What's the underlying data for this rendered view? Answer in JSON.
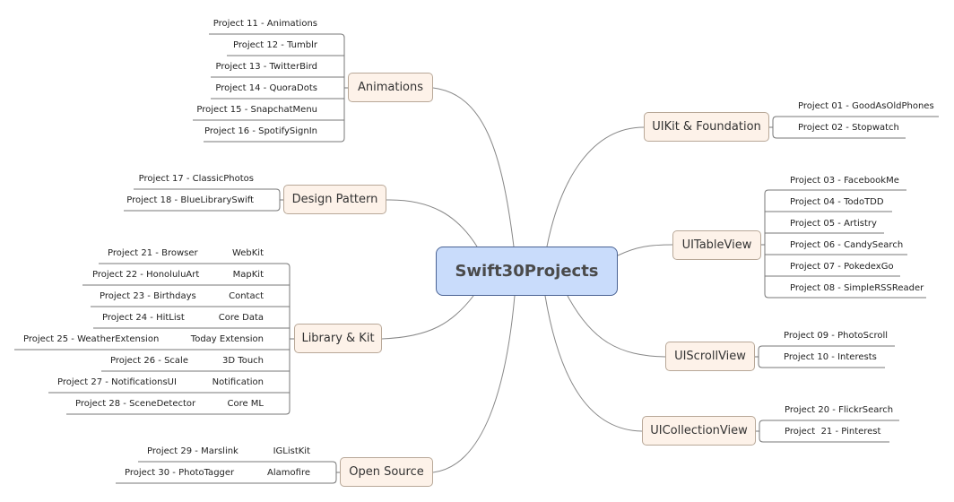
{
  "root": {
    "label": "Swift30Projects",
    "fill": "#c9dcfb",
    "border": "#4a6394"
  },
  "colors": {
    "branch_fill": "#fdf2e9",
    "branch_border": "#b8a898",
    "line": "#888888"
  },
  "branches": {
    "uikit": {
      "label": "UIKit & Foundation",
      "items": [
        "Project 01 - GoodAsOldPhones",
        "Project 02 - Stopwatch"
      ]
    },
    "tableview": {
      "label": "UITableView",
      "items": [
        "Project 03 - FacebookMe",
        "Project 04 - TodoTDD",
        "Project 05 - Artistry",
        "Project 06 - CandySearch",
        "Project 07 - PokedexGo",
        "Project 08 - SimpleRSSReader"
      ]
    },
    "scrollview": {
      "label": "UIScrollView",
      "items": [
        "Project 09 - PhotoScroll",
        "Project 10 - Interests"
      ]
    },
    "collectionview": {
      "label": "UICollectionView",
      "items": [
        "Project 20 - FlickrSearch",
        "Project  21 - Pinterest"
      ]
    },
    "animations": {
      "label": "Animations",
      "items": [
        "Project 11 - Animations",
        "Project 12 - Tumblr",
        "Project 13 - TwitterBird",
        "Project 14 - QuoraDots",
        "Project 15 - SnapchatMenu",
        "Project 16 - SpotifySignIn"
      ]
    },
    "design": {
      "label": "Design Pattern",
      "items": [
        "Project 17 - ClassicPhotos",
        "Project 18 - BlueLibrarySwift"
      ]
    },
    "library": {
      "label": "Library & Kit",
      "items": [
        {
          "project": "Project 21 - Browser",
          "kit": "WebKit"
        },
        {
          "project": "Project 22 - HonoluluArt",
          "kit": "MapKit"
        },
        {
          "project": "Project 23 - Birthdays",
          "kit": "Contact"
        },
        {
          "project": "Project 24 - HitList",
          "kit": "Core Data"
        },
        {
          "project": "Project 25 - WeatherExtension",
          "kit": "Today Extension"
        },
        {
          "project": "Project 26 - Scale",
          "kit": "3D Touch"
        },
        {
          "project": "Project 27 - NotificationsUI",
          "kit": "Notification"
        },
        {
          "project": "Project 28 - SceneDetector",
          "kit": "Core ML"
        }
      ]
    },
    "opensource": {
      "label": "Open Source",
      "items": [
        {
          "project": "Project 29 - Marslink",
          "kit": "IGListKit"
        },
        {
          "project": "Project 30 - PhotoTagger",
          "kit": "Alamofire"
        }
      ]
    }
  }
}
